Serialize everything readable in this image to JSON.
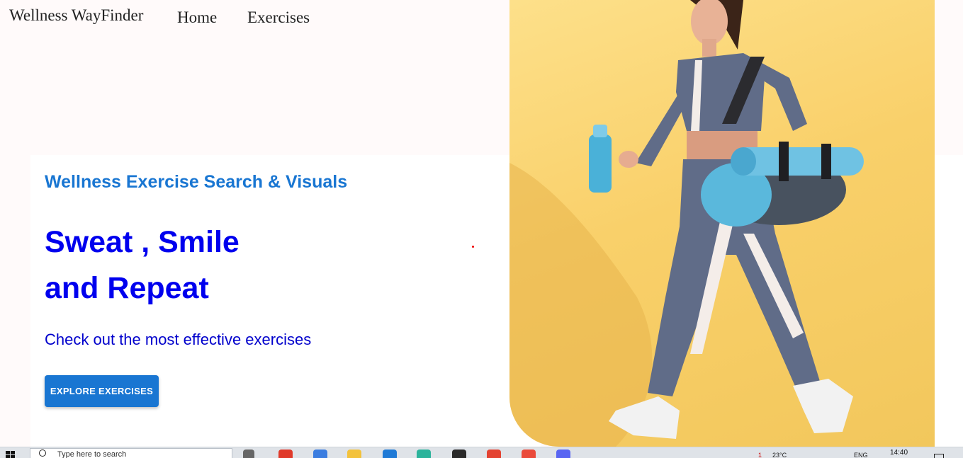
{
  "nav": {
    "brand": "Wellness WayFinder",
    "links": [
      "Home",
      "Exercises"
    ]
  },
  "hero": {
    "subtitle": "Wellness Exercise Search & Visuals",
    "headline_line1": "Sweat , Smile",
    "headline_line2": "and Repeat",
    "tagline": "Check out the most effective exercises",
    "cta_label": "EXPLORE EXERCISES"
  },
  "colors": {
    "page_bg": "#fffafa",
    "accent_blue": "#1976d2",
    "headline_blue": "#0000ee",
    "photo_bg": "#f9d06a"
  },
  "taskbar": {
    "search_text": "Type here to search",
    "weather": "23°C",
    "lang": "ENG",
    "clock": "14:40",
    "notification_count": "1"
  }
}
